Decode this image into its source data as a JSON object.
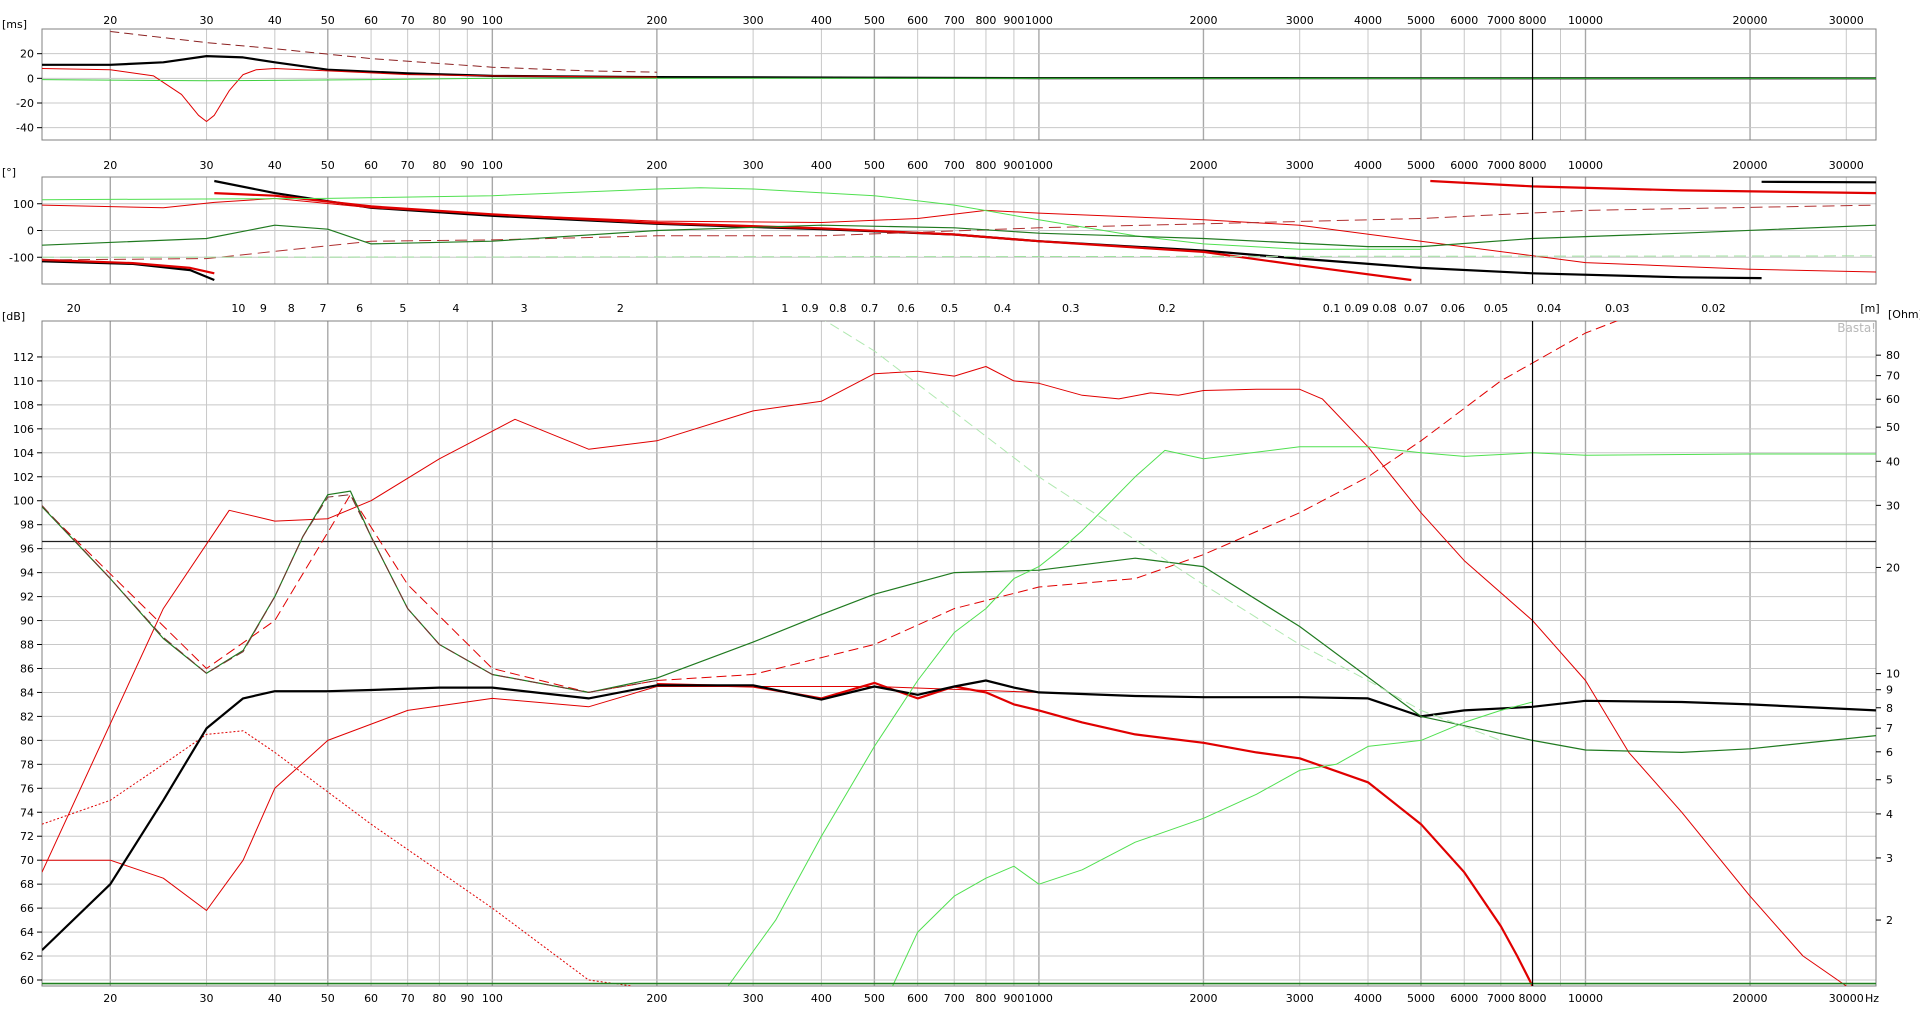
{
  "chart_data": [
    {
      "type": "line",
      "panel": "group-delay",
      "xscale": "log",
      "xlim": [
        15,
        34000
      ],
      "ylim": [
        -50,
        40
      ],
      "ylabel": "[ms]",
      "x_ticks": [
        "20",
        "30",
        "40",
        "50",
        "60",
        "70",
        "80",
        "90",
        "100",
        "200",
        "300",
        "400",
        "500",
        "600",
        "700",
        "800",
        "900",
        "1000",
        "2000",
        "3000",
        "4000",
        "5000",
        "6000",
        "7000",
        "8000",
        "10000",
        "20000",
        "30000"
      ],
      "y_ticks": [
        "20",
        "0",
        "-20",
        "-40"
      ],
      "y_tick_values": [
        20,
        0,
        -20,
        -40
      ],
      "cursor_x": 8000,
      "series": [
        {
          "color": "#000000",
          "width": 2.2,
          "x": [
            15,
            20,
            25,
            30,
            35,
            40,
            50,
            70,
            100,
            200,
            500,
            1000,
            34000
          ],
          "y": [
            11,
            11,
            13,
            18,
            17,
            13,
            7,
            4,
            2,
            1,
            0.5,
            0.2,
            0
          ]
        },
        {
          "color": "#e00000",
          "width": 1,
          "x": [
            15,
            20,
            24,
            27,
            29,
            30,
            31,
            33,
            35,
            37,
            40,
            50,
            70,
            100,
            200
          ],
          "y": [
            8,
            7,
            2,
            -13,
            -30,
            -35,
            -30,
            -10,
            3,
            7,
            8,
            6,
            3,
            2,
            1
          ]
        },
        {
          "color": "#8b2020",
          "width": 1,
          "dash": "9,5",
          "x": [
            20,
            30,
            40,
            60,
            100,
            150,
            200
          ],
          "y": [
            38,
            29,
            24,
            16,
            9,
            6,
            5
          ]
        },
        {
          "color": "#40d040",
          "width": 1,
          "x": [
            15,
            30,
            60,
            100,
            200,
            400,
            1000,
            34000
          ],
          "y": [
            -1,
            -2,
            -1,
            0,
            0,
            0,
            0,
            0
          ]
        }
      ]
    },
    {
      "type": "line",
      "panel": "phase",
      "xscale": "log",
      "xlim": [
        15,
        34000
      ],
      "ylim": [
        -200,
        200
      ],
      "ylabel": "[°]",
      "x_ticks": [
        "20",
        "30",
        "40",
        "50",
        "60",
        "70",
        "80",
        "90",
        "100",
        "200",
        "300",
        "400",
        "500",
        "600",
        "700",
        "800",
        "900",
        "1000",
        "2000",
        "3000",
        "4000",
        "5000",
        "6000",
        "7000",
        "8000",
        "10000",
        "20000",
        "30000"
      ],
      "y_ticks": [
        "100",
        "0",
        "-100"
      ],
      "y_tick_values": [
        100,
        0,
        -100
      ],
      "cursor_x": 8000,
      "series": [
        {
          "color": "#000000",
          "width": 2.2,
          "x": [
            15,
            22,
            28,
            31
          ],
          "y": [
            -115,
            -125,
            -148,
            -185
          ]
        },
        {
          "color": "#000000",
          "width": 2.2,
          "x": [
            31,
            40,
            60,
            100,
            200,
            400,
            700,
            1000,
            2000,
            3000,
            5000,
            8000,
            15000,
            21000
          ],
          "y": [
            185,
            140,
            85,
            55,
            25,
            5,
            -15,
            -40,
            -75,
            -105,
            -140,
            -160,
            -175,
            -178
          ]
        },
        {
          "color": "#000000",
          "width": 2.2,
          "x": [
            21000,
            34000
          ],
          "y": [
            182,
            180
          ]
        },
        {
          "color": "#e00000",
          "width": 2.2,
          "x": [
            15,
            22,
            28,
            31
          ],
          "y": [
            -110,
            -122,
            -140,
            -160
          ]
        },
        {
          "color": "#e00000",
          "width": 2.2,
          "x": [
            31,
            40,
            60,
            100,
            200,
            400,
            700,
            1000,
            2000,
            3000,
            4800
          ],
          "y": [
            140,
            130,
            90,
            60,
            28,
            8,
            -15,
            -40,
            -80,
            -130,
            -185
          ]
        },
        {
          "color": "#e00000",
          "width": 2.2,
          "x": [
            5200,
            8000,
            15000,
            34000
          ],
          "y": [
            185,
            165,
            150,
            140
          ]
        },
        {
          "color": "#e00000",
          "width": 1,
          "x": [
            15,
            25,
            31,
            40,
            60,
            100,
            200,
            400,
            600,
            800,
            1000,
            2000,
            3000,
            5000,
            10000,
            20000,
            34000
          ],
          "y": [
            95,
            85,
            105,
            120,
            85,
            60,
            35,
            30,
            45,
            75,
            65,
            40,
            20,
            -40,
            -120,
            -145,
            -155
          ]
        },
        {
          "color": "#b03030",
          "width": 1,
          "dash": "12,6",
          "x": [
            15,
            30,
            60,
            100,
            200,
            400,
            1000,
            2000,
            5000,
            10000,
            34000
          ],
          "y": [
            -110,
            -105,
            -40,
            -35,
            -20,
            -20,
            10,
            25,
            45,
            75,
            95
          ]
        },
        {
          "color": "#50e050",
          "width": 1,
          "x": [
            15,
            50,
            100,
            200,
            240,
            300,
            500,
            700,
            1000,
            1500,
            2000,
            3000,
            5000
          ],
          "y": [
            115,
            120,
            130,
            155,
            160,
            155,
            130,
            95,
            40,
            -20,
            -50,
            -70,
            -70
          ]
        },
        {
          "color": "#207a20",
          "width": 1.2,
          "x": [
            15,
            30,
            40,
            50,
            60,
            100,
            200,
            400,
            700,
            1000,
            2000,
            4000,
            5000,
            8000,
            15000,
            34000
          ],
          "y": [
            -55,
            -30,
            20,
            5,
            -50,
            -40,
            0,
            20,
            10,
            -10,
            -30,
            -60,
            -60,
            -30,
            -10,
            20
          ]
        },
        {
          "color": "#a0e0a0",
          "width": 1,
          "dash": "12,6",
          "x": [
            15,
            34000
          ],
          "y": [
            -100,
            -95
          ]
        }
      ]
    },
    {
      "type": "line",
      "panel": "spl",
      "xscale": "log",
      "xlim": [
        15,
        34000
      ],
      "ylim": [
        59.5,
        115
      ],
      "ylabel": "[dB]",
      "y2label": "[Ohm]",
      "x2label": "[m]",
      "xlabel": "Hz",
      "watermark": "Basta!",
      "x_ticks": [
        "20",
        "30",
        "40",
        "50",
        "60",
        "70",
        "80",
        "90",
        "100",
        "200",
        "300",
        "400",
        "500",
        "600",
        "700",
        "800",
        "900",
        "1000",
        "2000",
        "3000",
        "4000",
        "5000",
        "6000",
        "7000",
        "8000",
        "10000",
        "20000",
        "30000"
      ],
      "y_ticks": [
        "112",
        "110",
        "108",
        "106",
        "104",
        "102",
        "100",
        "98",
        "96",
        "94",
        "92",
        "90",
        "88",
        "86",
        "84",
        "82",
        "80",
        "78",
        "76",
        "74",
        "72",
        "70",
        "68",
        "66",
        "64",
        "62",
        "60"
      ],
      "y2_ticks": [
        "80",
        "70",
        "60",
        "50",
        "40",
        "30",
        "20",
        "10",
        "9",
        "8",
        "7",
        "6",
        "5",
        "4",
        "3",
        "2"
      ],
      "m_ticks": [
        "20",
        "10",
        "9",
        "8",
        "7",
        "6",
        "5",
        "4",
        "3",
        "2",
        "1",
        "0.9",
        "0.8",
        "0.7",
        "0.6",
        "0.5",
        "0.4",
        "0.3",
        "0.2",
        "0.1",
        "0.09",
        "0.08",
        "0.07",
        "0.06",
        "0.05",
        "0.04",
        "0.03",
        "0.02"
      ],
      "hline_y": 96.6,
      "cursor_x": 8000,
      "series": [
        {
          "color": "#e00000",
          "width": 1,
          "x": [
            15,
            25,
            33,
            40,
            50,
            60,
            80,
            100,
            110,
            150,
            200,
            300,
            400,
            500,
            600,
            700,
            800,
            900,
            1000,
            1200,
            1400,
            1600,
            1800,
            2000,
            2500,
            3000,
            3300,
            4000,
            5000,
            6000,
            8000,
            10000,
            12000,
            15000,
            20000,
            25000,
            30000
          ],
          "y": [
            69,
            91,
            99.2,
            98.3,
            98.5,
            100,
            103.5,
            105.8,
            106.8,
            104.3,
            105,
            107.5,
            108.3,
            110.6,
            110.8,
            110.4,
            111.2,
            110,
            109.8,
            108.8,
            108.5,
            109,
            108.8,
            109.2,
            109.3,
            109.3,
            108.5,
            104.5,
            99,
            95,
            90,
            85,
            79,
            74,
            67,
            62,
            59.5
          ]
        },
        {
          "color": "#e00000",
          "width": 1,
          "dash": "2,2",
          "x": [
            15,
            20,
            25,
            30,
            35,
            40,
            60,
            100,
            150,
            180
          ],
          "y": [
            73,
            75,
            78,
            80.5,
            80.8,
            79,
            73,
            66,
            60,
            59.5
          ]
        },
        {
          "color": "#e00000",
          "width": 1,
          "x": [
            15,
            20,
            25,
            30,
            35,
            40,
            50,
            70,
            100,
            150,
            200,
            300,
            500,
            1000
          ],
          "y": [
            70,
            70,
            68.5,
            65.8,
            70,
            76,
            80,
            82.5,
            83.5,
            82.8,
            84.5,
            84.5,
            84.5,
            84
          ]
        },
        {
          "color": "#e00000",
          "width": 1,
          "dash": "10,5",
          "x": [
            15,
            30,
            40,
            55,
            70,
            100,
            150,
            200,
            300,
            500,
            700,
            1000,
            1500,
            2000,
            3000,
            4000,
            5000,
            7000,
            10000,
            13000
          ],
          "y": [
            99.5,
            86,
            90,
            100.5,
            93,
            86,
            84,
            85,
            85.5,
            88,
            91,
            92.8,
            93.5,
            95.5,
            99,
            102,
            105,
            110,
            114,
            116
          ]
        },
        {
          "color": "#e00000",
          "width": 2.2,
          "x": [
            200,
            300,
            400,
            500,
            600,
            700,
            800,
            900,
            1000,
            1200,
            1500,
            2000,
            2500,
            3000,
            4000,
            5000,
            6000,
            7000,
            7500,
            8000
          ],
          "y": [
            84.7,
            84.5,
            83.5,
            84.8,
            83.5,
            84.5,
            84,
            83,
            82.5,
            81.5,
            80.5,
            79.8,
            79,
            78.5,
            76.5,
            73,
            69,
            64.5,
            62,
            59.5
          ]
        },
        {
          "color": "#000000",
          "width": 2.2,
          "x": [
            15,
            20,
            25,
            30,
            35,
            40,
            50,
            60,
            80,
            100,
            150,
            200,
            300,
            400,
            500,
            600,
            700,
            800,
            900,
            1000,
            1500,
            2000,
            3000,
            4000,
            5000,
            6000,
            8000,
            10000,
            15000,
            20000,
            34000
          ],
          "y": [
            62.5,
            68,
            75,
            81,
            83.5,
            84.1,
            84.1,
            84.2,
            84.4,
            84.4,
            83.5,
            84.6,
            84.6,
            83.4,
            84.5,
            83.8,
            84.5,
            85,
            84.4,
            84,
            83.7,
            83.6,
            83.6,
            83.5,
            82,
            82.5,
            82.8,
            83.3,
            83.2,
            83,
            82.5
          ]
        },
        {
          "color": "#207a20",
          "width": 1.2,
          "x": [
            15,
            20,
            25,
            30,
            35,
            40,
            45,
            50,
            55,
            60,
            70,
            80,
            100,
            150,
            200,
            300,
            400,
            500,
            700,
            1000,
            1500,
            2000,
            3000,
            5000,
            8000,
            10000,
            15000,
            20000,
            34000
          ],
          "y": [
            99.5,
            93.5,
            88.5,
            85.6,
            87.5,
            92,
            97,
            100.5,
            100.8,
            97,
            91,
            88,
            85.5,
            84,
            85.2,
            88.2,
            90.5,
            92.2,
            94,
            94.2,
            95.2,
            94.5,
            89.5,
            82,
            80,
            79.2,
            79,
            79.3,
            80.4
          ]
        },
        {
          "color": "#7a3030",
          "width": 1,
          "dash": "10,5",
          "x": [
            15,
            20,
            25,
            30,
            35,
            40,
            45,
            50,
            55,
            60,
            70,
            80,
            100,
            150,
            200
          ],
          "y": [
            99.6,
            93.5,
            88.6,
            85.6,
            87.4,
            92,
            97,
            100.3,
            100.5,
            97,
            91,
            88,
            85.5,
            84,
            85
          ]
        },
        {
          "color": "#50e050",
          "width": 1,
          "x": [
            270,
            330,
            400,
            500,
            600,
            700,
            800,
            900,
            1000,
            1100,
            1200,
            1500,
            1700,
            2000,
            3000,
            4000,
            5000,
            6000,
            8000,
            10000,
            20000,
            34000
          ],
          "y": [
            59.5,
            65,
            72,
            79.5,
            85,
            89,
            91,
            93.5,
            94.5,
            96,
            97.5,
            102,
            104.2,
            103.5,
            104.5,
            104.5,
            104,
            103.7,
            104,
            103.8,
            103.9,
            103.9
          ]
        },
        {
          "color": "#50e050",
          "width": 1,
          "x": [
            540,
            600,
            700,
            800,
            900,
            1000,
            1200,
            1500,
            2000,
            2500,
            3000,
            3500,
            4000,
            5000,
            6000,
            7000,
            8000
          ],
          "y": [
            59.5,
            64,
            67,
            68.5,
            69.5,
            68,
            69.2,
            71.5,
            73.5,
            75.5,
            77.5,
            78,
            79.5,
            80,
            81.5,
            82.5,
            83.2
          ]
        },
        {
          "color": "#b0e8b0",
          "width": 1,
          "dash": "10,5",
          "x": [
            230,
            500,
            1000,
            2000,
            3000,
            4000,
            5000,
            7000
          ],
          "y": [
            122,
            112.5,
            102,
            93,
            88,
            85,
            82.5,
            80
          ]
        },
        {
          "color": "#208020",
          "width": 1.6,
          "x": [
            15,
            34000
          ],
          "y": [
            59.7,
            59.7
          ]
        }
      ]
    }
  ]
}
